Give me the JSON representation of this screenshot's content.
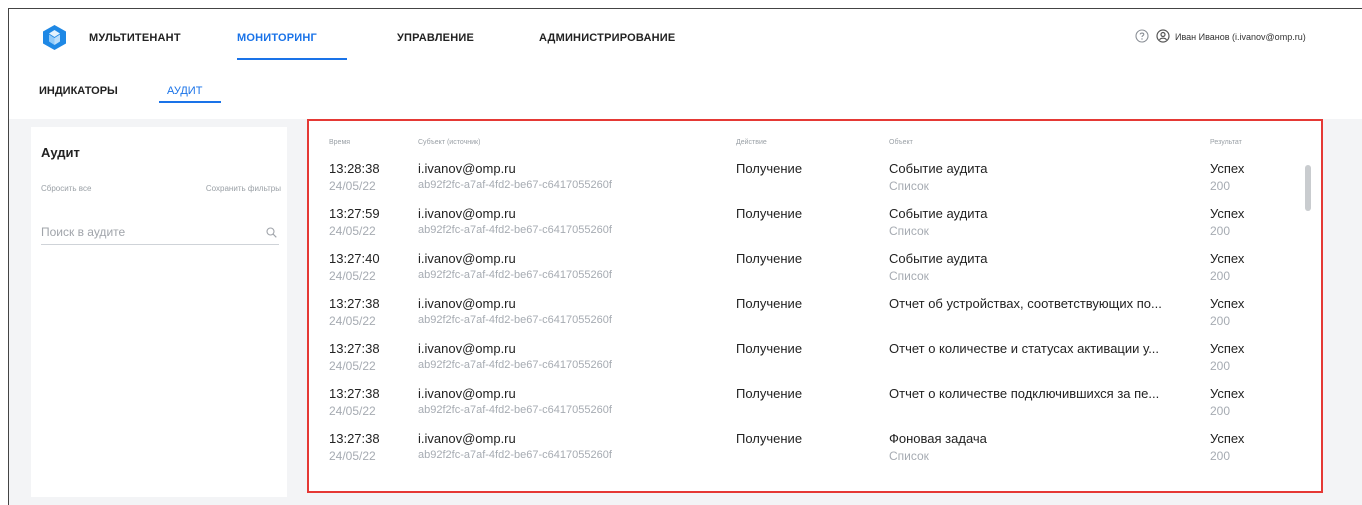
{
  "nav": {
    "items": [
      "МУЛЬТИТЕНАНТ",
      "МОНИТОРИНГ",
      "УПРАВЛЕНИЕ",
      "АДМИНИСТРИРОВАНИЕ"
    ],
    "active": "МОНИТОРИНГ",
    "user": "Иван Иванов (i.ivanov@omp.ru)"
  },
  "subnav": {
    "items": [
      "ИНДИКАТОРЫ",
      "АУДИТ"
    ],
    "active": "АУДИТ"
  },
  "sidebar": {
    "title": "Аудит",
    "reset_label": "Сбросить все",
    "save_label": "Сохранить фильтры",
    "search_placeholder": "Поиск в аудите"
  },
  "table": {
    "headers": [
      "Время",
      "Субъект (источник)",
      "Действие",
      "Объект",
      "Результат"
    ],
    "rows": [
      {
        "time": "13:28:38",
        "date": "24/05/22",
        "subject": "i.ivanov@omp.ru",
        "source": "ab92f2fc-a7af-4fd2-be67-c6417055260f",
        "action": "Получение",
        "object": "Событие аудита",
        "object_sub": "Список",
        "result": "Успех",
        "code": "200"
      },
      {
        "time": "13:27:59",
        "date": "24/05/22",
        "subject": "i.ivanov@omp.ru",
        "source": "ab92f2fc-a7af-4fd2-be67-c6417055260f",
        "action": "Получение",
        "object": "Событие аудита",
        "object_sub": "Список",
        "result": "Успех",
        "code": "200"
      },
      {
        "time": "13:27:40",
        "date": "24/05/22",
        "subject": "i.ivanov@omp.ru",
        "source": "ab92f2fc-a7af-4fd2-be67-c6417055260f",
        "action": "Получение",
        "object": "Событие аудита",
        "object_sub": "Список",
        "result": "Успех",
        "code": "200"
      },
      {
        "time": "13:27:38",
        "date": "24/05/22",
        "subject": "i.ivanov@omp.ru",
        "source": "ab92f2fc-a7af-4fd2-be67-c6417055260f",
        "action": "Получение",
        "object": "Отчет об устройствах, соответствующих по...",
        "object_sub": "",
        "result": "Успех",
        "code": "200"
      },
      {
        "time": "13:27:38",
        "date": "24/05/22",
        "subject": "i.ivanov@omp.ru",
        "source": "ab92f2fc-a7af-4fd2-be67-c6417055260f",
        "action": "Получение",
        "object": "Отчет о количестве и статусах активации у...",
        "object_sub": "",
        "result": "Успех",
        "code": "200"
      },
      {
        "time": "13:27:38",
        "date": "24/05/22",
        "subject": "i.ivanov@omp.ru",
        "source": "ab92f2fc-a7af-4fd2-be67-c6417055260f",
        "action": "Получение",
        "object": "Отчет о количестве подключившихся за пе...",
        "object_sub": "",
        "result": "Успех",
        "code": "200"
      },
      {
        "time": "13:27:38",
        "date": "24/05/22",
        "subject": "i.ivanov@omp.ru",
        "source": "ab92f2fc-a7af-4fd2-be67-c6417055260f",
        "action": "Получение",
        "object": "Фоновая задача",
        "object_sub": "Список",
        "result": "Успех",
        "code": "200"
      }
    ]
  },
  "colors": {
    "accent": "#1a73e8",
    "highlight_border": "#e53935",
    "logo": "#1e88e5"
  },
  "icons": [
    "logo-icon",
    "help-icon",
    "user-icon",
    "search-icon"
  ]
}
